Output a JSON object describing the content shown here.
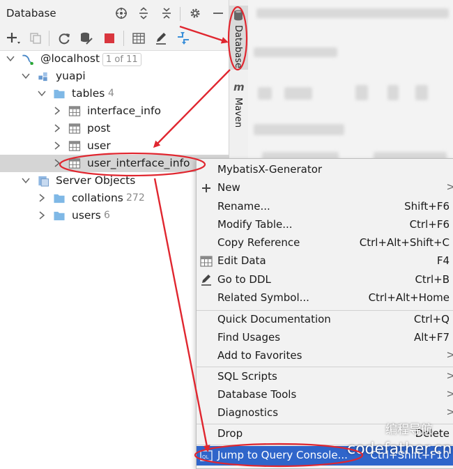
{
  "panel": {
    "title": "Database",
    "header_icons": [
      "crosshair-icon",
      "expand-all-icon",
      "collapse-all-icon",
      "gear-icon",
      "minimize-icon"
    ],
    "toolbar_icons": [
      "add-icon",
      "copy-icon",
      "refresh-icon",
      "schema-icon",
      "stop-icon",
      "table-icon",
      "edit-icon",
      "jump-icon"
    ]
  },
  "tree": {
    "root": {
      "label": "@localhost",
      "badge": "1 of 11"
    },
    "schema": {
      "label": "yuapi"
    },
    "tables": {
      "label": "tables",
      "count": "4"
    },
    "items": [
      {
        "label": "interface_info"
      },
      {
        "label": "post"
      },
      {
        "label": "user"
      },
      {
        "label": "user_interface_info"
      }
    ],
    "server": {
      "label": "Server Objects"
    },
    "collations": {
      "label": "collations",
      "count": "272"
    },
    "users": {
      "label": "users",
      "count": "6"
    }
  },
  "side_tabs": {
    "database": "Database",
    "maven": "Maven"
  },
  "menu": {
    "items": [
      {
        "label": "MybatisX-Generator",
        "shortcut": ""
      },
      {
        "label": "New",
        "shortcut": ""
      },
      {
        "label": "Rename...",
        "shortcut": "Shift+F6"
      },
      {
        "label": "Modify Table...",
        "shortcut": "Ctrl+F6"
      },
      {
        "label": "Copy Reference",
        "shortcut": "Ctrl+Alt+Shift+C"
      },
      {
        "label": "Edit Data",
        "shortcut": "F4"
      },
      {
        "label": "Go to DDL",
        "shortcut": "Ctrl+B"
      },
      {
        "label": "Related Symbol...",
        "shortcut": "Ctrl+Alt+Home"
      },
      {
        "label": "Quick Documentation",
        "shortcut": "Ctrl+Q"
      },
      {
        "label": "Find Usages",
        "shortcut": "Alt+F7"
      },
      {
        "label": "Add to Favorites",
        "shortcut": ""
      },
      {
        "label": "SQL Scripts",
        "shortcut": ""
      },
      {
        "label": "Database Tools",
        "shortcut": ""
      },
      {
        "label": "Diagnostics",
        "shortcut": ""
      },
      {
        "label": "Drop",
        "shortcut": "Delete"
      },
      {
        "label": "Jump to Query Console...",
        "shortcut": "Ctrl+Shift+F10"
      }
    ],
    "submenu_glyph": ">"
  },
  "watermark": {
    "cn": "编程导航",
    "site": "codefather.cn"
  },
  "colors": {
    "annotation": "#e0262f",
    "selection": "#2f65ca",
    "folder": "#7fb8e6"
  }
}
